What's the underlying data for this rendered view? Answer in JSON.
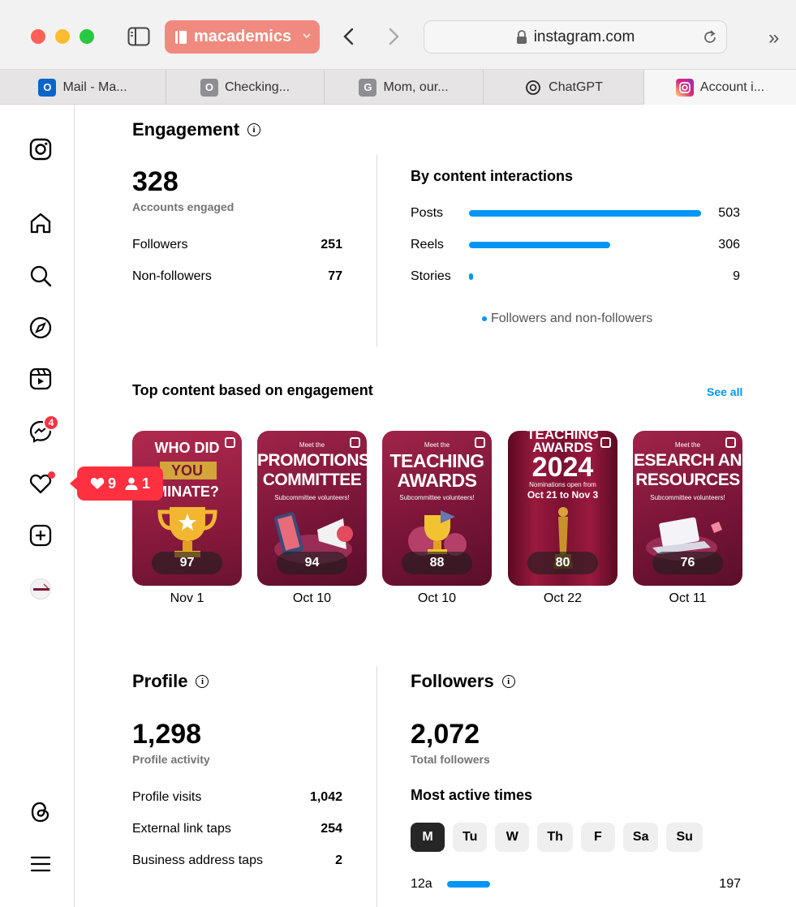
{
  "browser": {
    "profile_label": "macademics",
    "url": "instagram.com",
    "tabs": [
      {
        "label": "Mail - Ma...",
        "favicon": "O",
        "color": "#0a64c9"
      },
      {
        "label": "Checking...",
        "favicon": "O",
        "color": "#8e8e93"
      },
      {
        "label": "Mom, our...",
        "favicon": "G",
        "color": "#8e8e93"
      },
      {
        "label": "ChatGPT",
        "favicon": "",
        "color": "#ffffff"
      },
      {
        "label": "Account i...",
        "favicon": "",
        "color": "#e1306c"
      }
    ]
  },
  "rail": {
    "messages_badge": "4",
    "notif_likes": "9",
    "notif_follows": "1"
  },
  "engagement": {
    "title": "Engagement",
    "accounts_engaged": "328",
    "accounts_engaged_label": "Accounts engaged",
    "followers_label": "Followers",
    "followers_value": "251",
    "nonfollowers_label": "Non-followers",
    "nonfollowers_value": "77",
    "interactions_title": "By content interactions",
    "legend": "Followers and non-followers"
  },
  "chart_data": {
    "type": "bar",
    "title": "By content interactions",
    "categories": [
      "Posts",
      "Reels",
      "Stories"
    ],
    "values": [
      503,
      306,
      9
    ],
    "values_text": [
      "503",
      "306",
      "9"
    ],
    "series": [
      {
        "name": "Followers and non-followers",
        "values": [
          503,
          306,
          9
        ]
      }
    ],
    "xlim": [
      0,
      503
    ],
    "orientation": "horizontal"
  },
  "top_content": {
    "title": "Top content based on engagement",
    "see_all": "See all",
    "items": [
      {
        "line1": "WHO DID",
        "line2": "YOU",
        "line3": "MINATE?",
        "count": "97",
        "date": "Nov 1"
      },
      {
        "meet": "Meet the",
        "line1": "PROMOTIONS",
        "line2": "COMMITTEE",
        "sub": "Subcommittee volunteers!",
        "count": "94",
        "date": "Oct 10"
      },
      {
        "meet": "Meet the",
        "line1": "TEACHING",
        "line2": "AWARDS",
        "sub": "Subcommittee volunteers!",
        "count": "88",
        "date": "Oct 10"
      },
      {
        "line1": "TEACHING",
        "line2": "AWARDS",
        "line3": "2024",
        "sub": "Nominations open from",
        "sub2": "Oct 21 to Nov 3",
        "count": "80",
        "date": "Oct 22"
      },
      {
        "meet": "Meet the",
        "line1": "ESEARCH AN",
        "line2": "RESOURCES",
        "sub": "Subcommittee volunteers!",
        "count": "76",
        "date": "Oct 11"
      }
    ]
  },
  "profile": {
    "title": "Profile",
    "activity": "1,298",
    "activity_label": "Profile activity",
    "rows": [
      {
        "label": "Profile visits",
        "value": "1,042"
      },
      {
        "label": "External link taps",
        "value": "254"
      },
      {
        "label": "Business address taps",
        "value": "2"
      }
    ]
  },
  "followers": {
    "title": "Followers",
    "total": "2,072",
    "total_label": "Total followers",
    "active_title": "Most active times",
    "days": [
      "M",
      "Tu",
      "W",
      "Th",
      "F",
      "Sa",
      "Su"
    ],
    "selected_day": "M",
    "time_label": "12a",
    "time_value": "197",
    "time_fraction": 0.19
  }
}
